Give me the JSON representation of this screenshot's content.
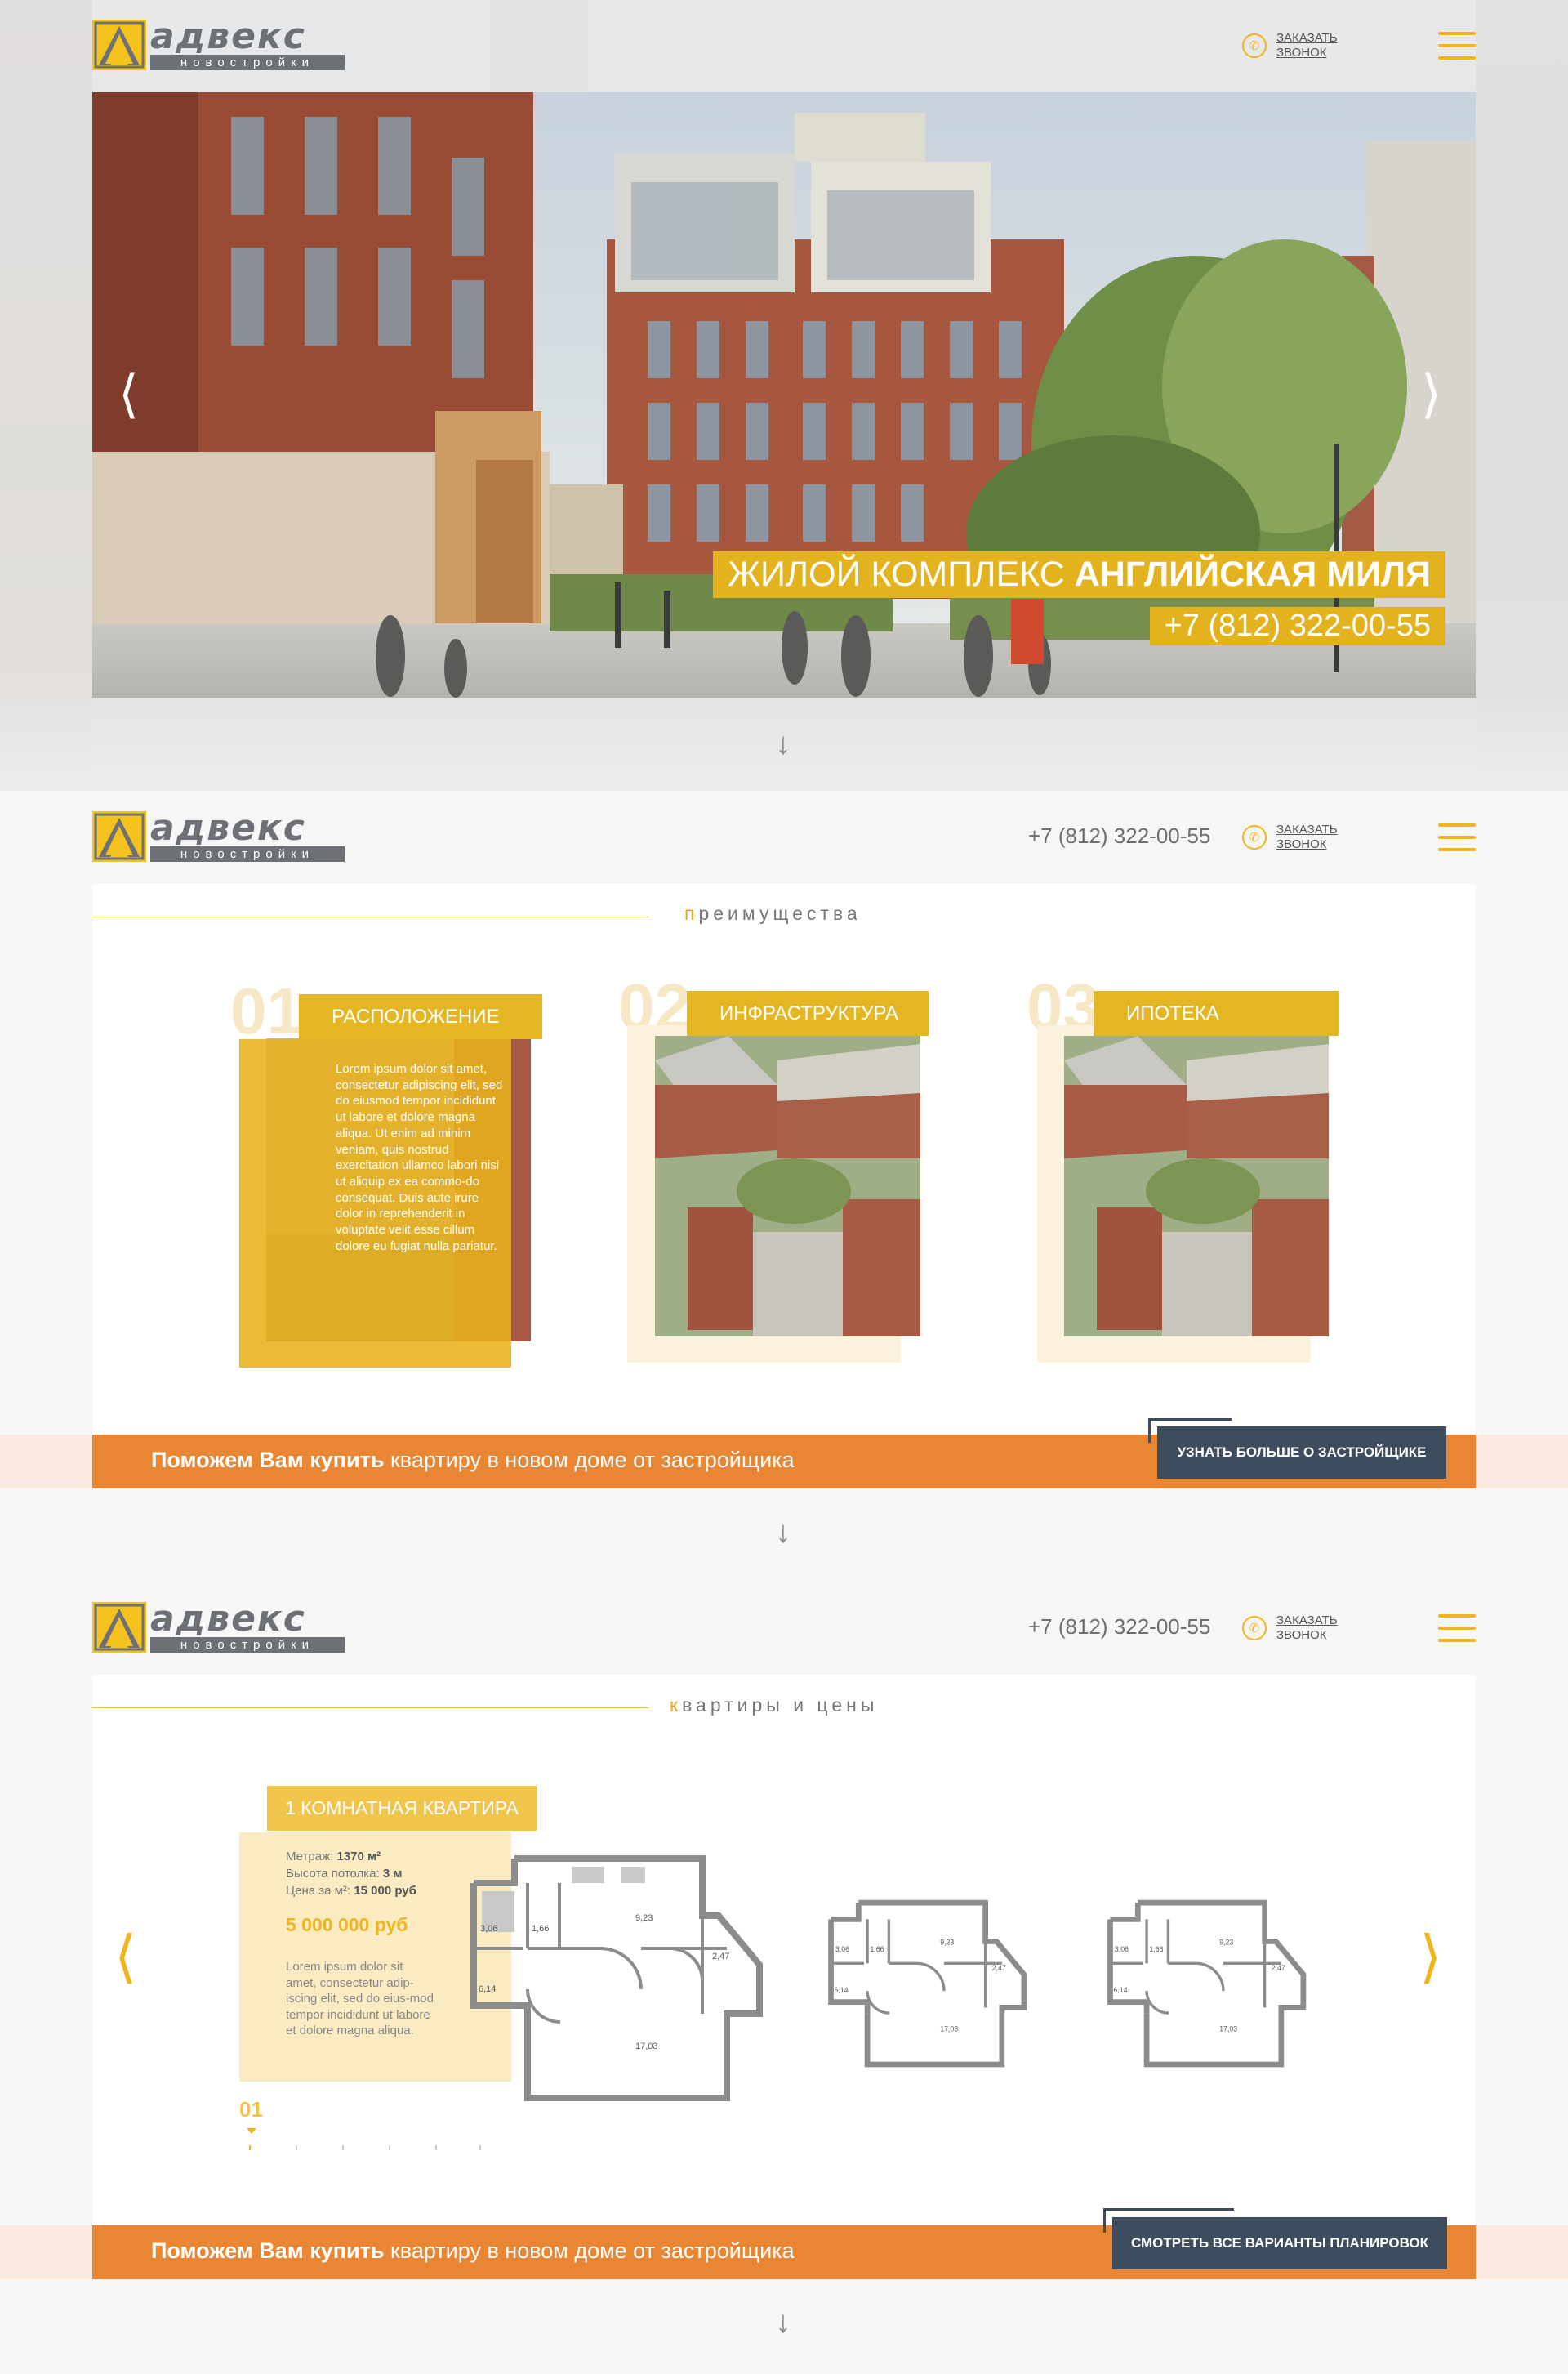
{
  "brand": {
    "name": "адвекс",
    "sub": "новостройки"
  },
  "header": {
    "phone": "+7 (812) 322-00-55",
    "callback": "Заказать звонок"
  },
  "hero": {
    "title_prefix": "ЖИЛОЙ КОМПЛЕКС",
    "title_bold": "АНГЛИЙСКАЯ МИЛЯ",
    "phone": "+7 (812) 322-00-55"
  },
  "advantages": {
    "title_first": "п",
    "title_rest": "реимущества",
    "items": [
      {
        "num": "01",
        "label": "РАСПОЛОЖЕНИЕ",
        "text": "Lorem ipsum dolor sit amet, consectetur adipiscing elit, sed do eiusmod tempor incididunt ut labore et dolore magna aliqua. Ut enim ad minim veniam, quis nostrud exercitation ullamco labori nisi ut aliquip ex ea commo-do consequat. Duis aute irure dolor in reprehenderit in voluptate velit esse cillum dolore eu fugiat nulla pariatur."
      },
      {
        "num": "02",
        "label": "ИНФРАСТРУКТУРА"
      },
      {
        "num": "03",
        "label": "ИПОТЕКА"
      }
    ],
    "cta": {
      "bold": "Поможем Вам купить",
      "rest": "квартиру в новом доме от застройщика",
      "button": "УЗНАТЬ БОЛЬШЕ О ЗАСТРОЙЩИКЕ"
    }
  },
  "apartments": {
    "title_first": "к",
    "title_rest": "вартиры и цены",
    "label": "1 КОМНАТНАЯ КВАРТИРА",
    "area_label": "Метраж:",
    "area_value": "1370 м²",
    "ceiling_label": "Высота потолка:",
    "ceiling_value": "3 м",
    "sqm_label": "Цена за м²:",
    "sqm_value": "15 000 руб",
    "price": "5 000 000 руб",
    "desc": "Lorem ipsum dolor sit amet, consectetur adip-iscing elit, sed do eius-mod tempor incididunt ut labore et dolore magna aliqua.",
    "page": "01",
    "rooms": [
      "3,06",
      "1,66",
      "9,23",
      "2,47",
      "6,14",
      "17,03"
    ],
    "cta": {
      "bold": "Поможем Вам купить",
      "rest": "квартиру в новом доме от застройщика",
      "button": "СМОТРЕТЬ ВСЕ ВАРИАНТЫ ПЛАНИРОВОК"
    }
  },
  "colors": {
    "accent": "#f0b51b",
    "orange": "#e88633",
    "dark_button": "#3d4d5e",
    "logo_gray": "#6d7075"
  },
  "icons": [
    "phone-icon",
    "burger-menu-icon",
    "arrow-left-icon",
    "arrow-right-icon",
    "arrow-down-icon"
  ]
}
